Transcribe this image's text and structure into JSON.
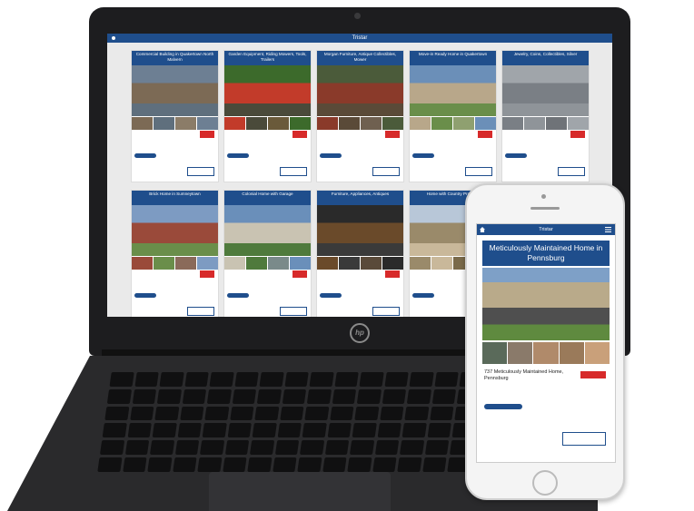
{
  "laptop": {
    "brand": "hp",
    "site_header": "Tristar",
    "listings": [
      {
        "title": "Commercial Building in Quakertown North Malvern",
        "colors": [
          "#6d7f93",
          "#7c6a55",
          "#5f6f7d",
          "#8b7c68"
        ]
      },
      {
        "title": "Garden Equipment, Riding Mowers, Tools, Trailers",
        "colors": [
          "#3c6a2b",
          "#c23b2a",
          "#4a4a3a",
          "#6a5a3a"
        ]
      },
      {
        "title": "Morgan Furniture, Antique Collectibles, Mower",
        "colors": [
          "#4b5b3a",
          "#8a3a2a",
          "#5a4a38",
          "#6f6050"
        ]
      },
      {
        "title": "Move-in Ready Home in Quakertown",
        "colors": [
          "#6b8fb8",
          "#b8a78a",
          "#6a8e4a",
          "#8fa070"
        ]
      },
      {
        "title": "Jewelry, Coins, Collectibles, Silver",
        "colors": [
          "#a0a5aa",
          "#7a7f85",
          "#8f9499",
          "#6f7378"
        ]
      },
      {
        "title": "Brick Home in Sumneytown",
        "colors": [
          "#7d9bc2",
          "#9a4a3a",
          "#6a8e4a",
          "#8a6a5a"
        ]
      },
      {
        "title": "Colonial Home with Garage",
        "colors": [
          "#6a8fba",
          "#c9c3b2",
          "#4f7a3c",
          "#7a8a8a"
        ]
      },
      {
        "title": "Furniture, Appliances, Antiques",
        "colors": [
          "#2a2a2a",
          "#6a4a2a",
          "#3a3a3a",
          "#5a4a3a"
        ]
      },
      {
        "title": "Home with Country Property",
        "colors": [
          "#b8c7d8",
          "#9a8a6a",
          "#c9b89a",
          "#7a6a4a"
        ]
      }
    ]
  },
  "phone": {
    "header_title": "Tristar",
    "listing_title": "Meticulously Maintained Home in Pennsburg",
    "address": "737 Meticulously Maintained Home, Pennsburg",
    "thumb_colors": [
      "#5a6a5a",
      "#8a7a6a",
      "#b08a6a",
      "#9a7a5a",
      "#c9a07a"
    ]
  }
}
